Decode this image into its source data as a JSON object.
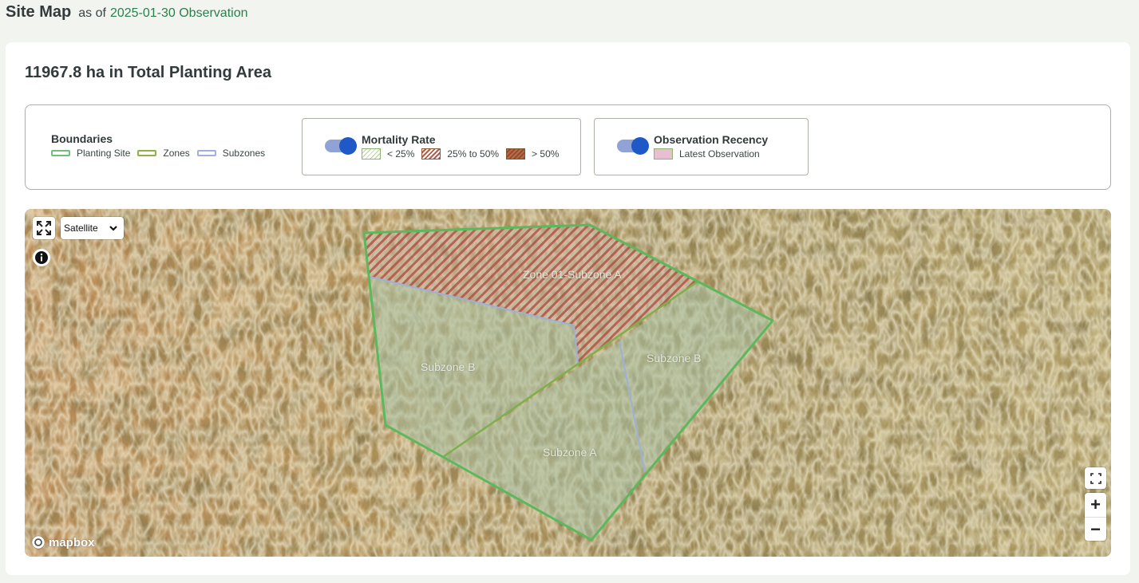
{
  "header": {
    "title": "Site Map",
    "as_of": "as of",
    "observation_link": "2025-01-30 Observation"
  },
  "summary": {
    "total_planting_area": "11967.8 ha in Total Planting Area"
  },
  "legend": {
    "boundaries": {
      "title": "Boundaries",
      "items": [
        {
          "label": "Planting Site",
          "color": "#6cc07a"
        },
        {
          "label": "Zones",
          "color": "#8db23e"
        },
        {
          "label": "Subzones",
          "color": "#a3aee0"
        }
      ]
    },
    "mortality_rate": {
      "title": "Mortality Rate",
      "enabled": true,
      "items": [
        {
          "label": "< 25%"
        },
        {
          "label": "25% to 50%"
        },
        {
          "label": "> 50%"
        }
      ]
    },
    "observation_recency": {
      "title": "Observation Recency",
      "enabled": true,
      "items": [
        {
          "label": "Latest Observation"
        }
      ]
    }
  },
  "map": {
    "style_select": {
      "value": "Satellite",
      "options": [
        "Satellite"
      ]
    },
    "labels": {
      "zone_01_subzone_a": "Zone 01-Subzone A",
      "subzone_b_west": "Subzone B",
      "subzone_b_east": "Subzone B",
      "subzone_a": "Subzone A"
    },
    "controls": {
      "zoom_in": "+",
      "zoom_out": "−"
    },
    "attribution": "mapbox",
    "icons": [
      "expand-icon",
      "info-icon",
      "fullscreen-icon",
      "chevron-down-icon",
      "mapbox-logo-icon"
    ]
  },
  "colors": {
    "accent_green": "#2e7d4e",
    "toggle_on": "#1f59c7",
    "planting_site_boundary": "#5cb85c",
    "mortality_high_hatch": "#b23c30"
  }
}
